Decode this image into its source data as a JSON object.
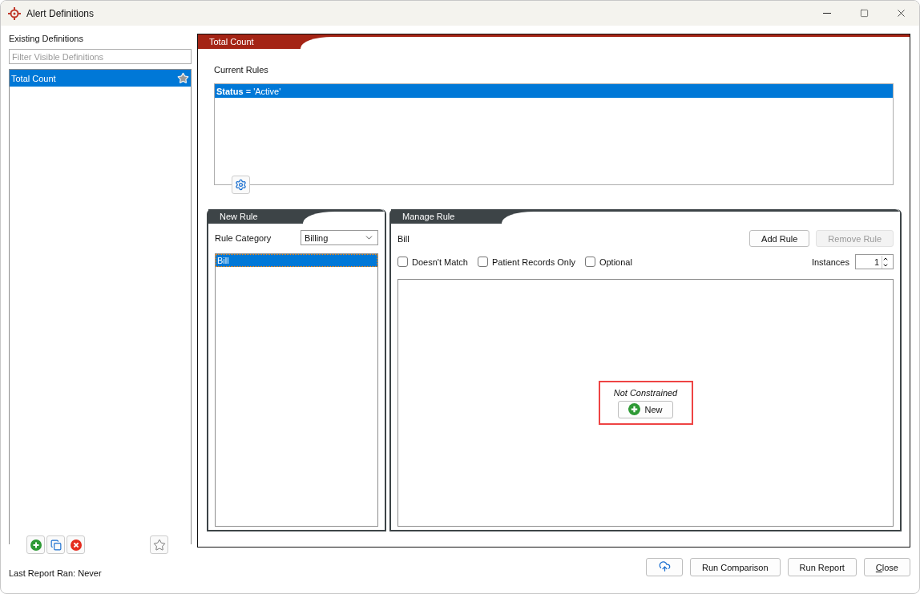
{
  "window": {
    "title": "Alert Definitions"
  },
  "definitions": {
    "label": "Existing Definitions",
    "filter_placeholder": "Filter Visible Definitions",
    "items": [
      {
        "label": "Total Count",
        "selected": true,
        "starred": true
      }
    ],
    "footer": "Last Report Ran: Never"
  },
  "definition": {
    "title": "Total Count",
    "current_rules_label": "Current Rules",
    "rules": [
      {
        "text": "**Status** = 'Active'",
        "selected": true
      }
    ]
  },
  "new_rule": {
    "title": "New Rule",
    "category_label": "Rule Category",
    "category_value": "Billing",
    "items": [
      {
        "label": "Bill",
        "selected": true
      }
    ]
  },
  "manage_rule": {
    "title": "Manage Rule",
    "rule_name": "Bill",
    "add_button": {
      "label": "Add Rule",
      "disabled": false
    },
    "remove_button": {
      "label": "Remove Rule",
      "disabled": true
    },
    "options": [
      {
        "label": "Doesn't Match",
        "checked": false
      },
      {
        "label": "Patient Records Only",
        "checked": false
      },
      {
        "label": "Optional",
        "checked": false
      }
    ],
    "instances_label": "Instances",
    "instances_value": "1",
    "constraint_text": "Not Constrained",
    "new_button": "New",
    "highlighted": true
  },
  "buttons": [
    {
      "kind": "icon"
    },
    {
      "kind": "text",
      "label": "Run Comparison"
    },
    {
      "kind": "text",
      "label": "Run Report"
    },
    {
      "kind": "mnemonic",
      "label": "Close"
    }
  ]
}
